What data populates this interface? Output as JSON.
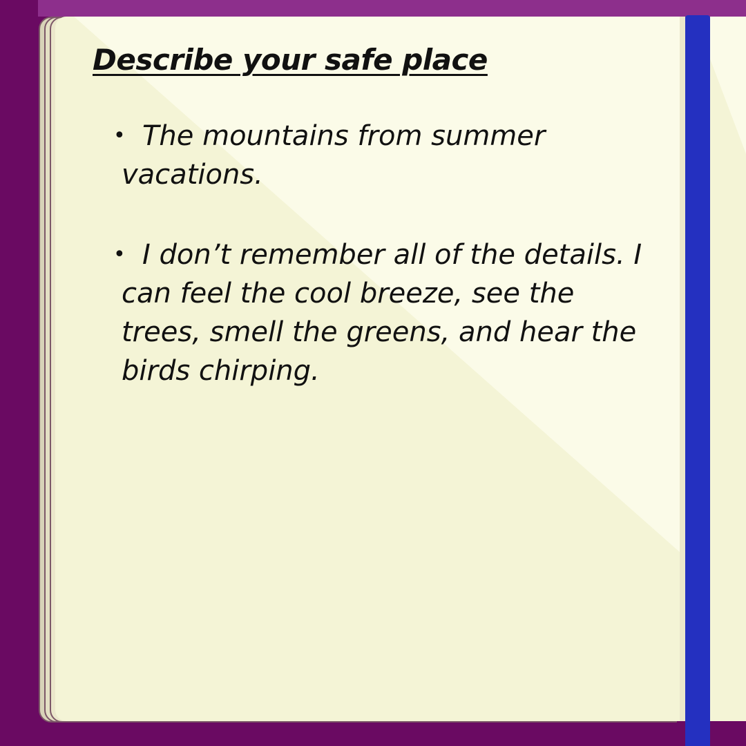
{
  "journal": {
    "heading": "Describe your safe place",
    "entries": [
      {
        "bullet": "•",
        "text": "The mountains from summer vacations."
      },
      {
        "bullet": "•",
        "text": "I don’t remember all of the details. I can feel the cool breeze, see the trees, smell the greens, and hear the birds chirping."
      }
    ]
  },
  "colors": {
    "background": "#6a0a62",
    "page": "#f4f4d6",
    "ribbon": "#2430c0"
  }
}
